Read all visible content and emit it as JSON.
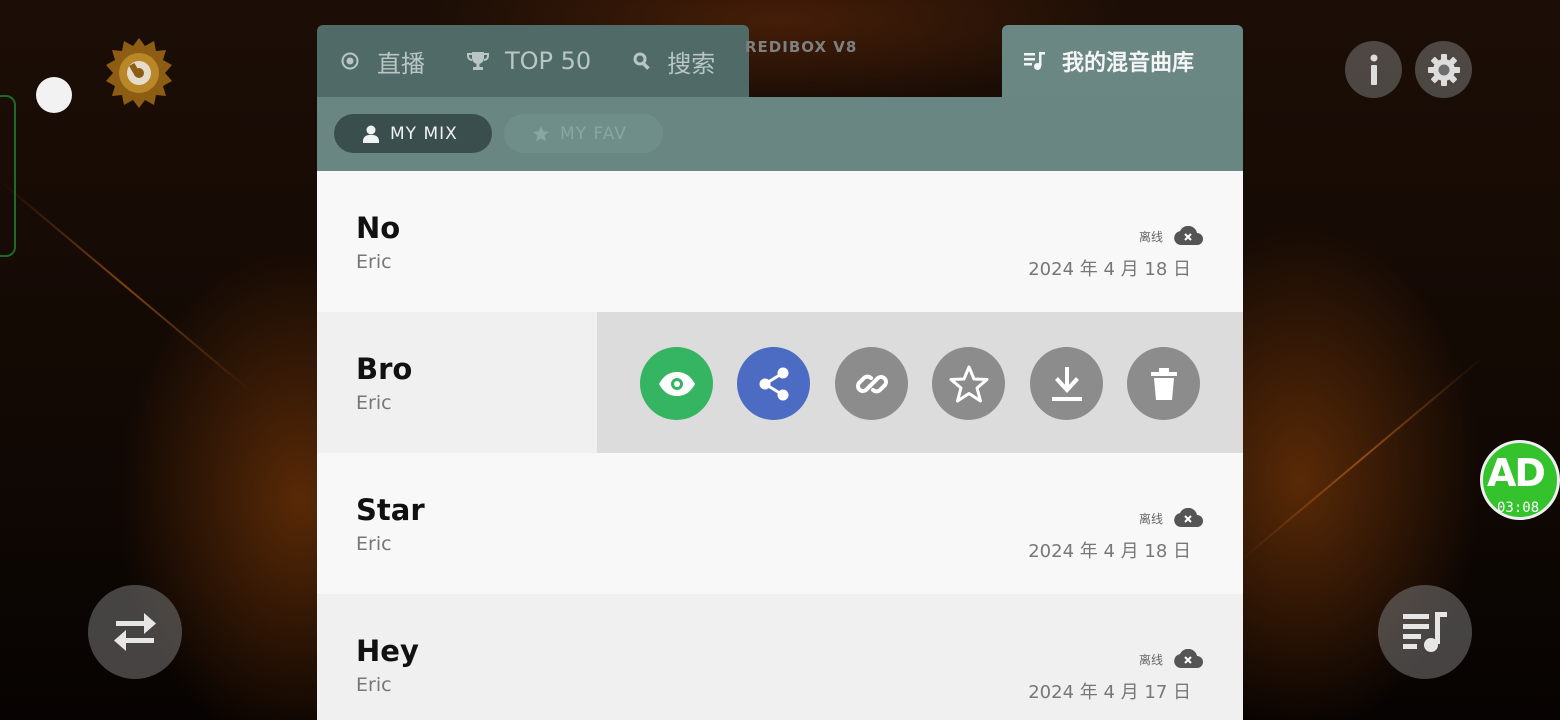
{
  "app": {
    "brand_text": "REDIBOX V8"
  },
  "tabs": {
    "live_label": "直播",
    "top50_label": "TOP 50",
    "search_label": "搜索",
    "my_library_label": "我的混音曲库"
  },
  "subtabs": {
    "my_mix_label": "MY MIX",
    "my_fav_label": "MY FAV"
  },
  "ad_badge": {
    "label": "AD",
    "timer": "03:08"
  },
  "list": {
    "rows": [
      {
        "title": "No",
        "artist": "Eric",
        "status": "离线",
        "date": "2024 年 4 月 18 日"
      },
      {
        "title": "Bro",
        "artist": "Eric"
      },
      {
        "title": "Star",
        "artist": "Eric",
        "status": "离线",
        "date": "2024 年 4 月 18 日"
      },
      {
        "title": "Hey",
        "artist": "Eric",
        "status": "离线",
        "date": "2024 年 4 月 17 日"
      }
    ]
  },
  "colors": {
    "tab_dark": "#4f6a67",
    "tab_active": "#6b8784",
    "pill_active": "#3a4f4d",
    "view_green": "#35b562",
    "share_blue": "#4c6bc2",
    "action_gray": "#8c8c8c",
    "ad_green": "#34c22d"
  },
  "icons": [
    "radio-icon",
    "trophy-icon",
    "search-icon",
    "playlist-music-icon",
    "person-icon",
    "star-icon",
    "cloud-off-icon",
    "eye-icon",
    "share-icon",
    "link-icon",
    "download-icon",
    "trash-icon",
    "info-icon",
    "gear-icon",
    "swap-icon",
    "vinyl-logo-icon"
  ]
}
